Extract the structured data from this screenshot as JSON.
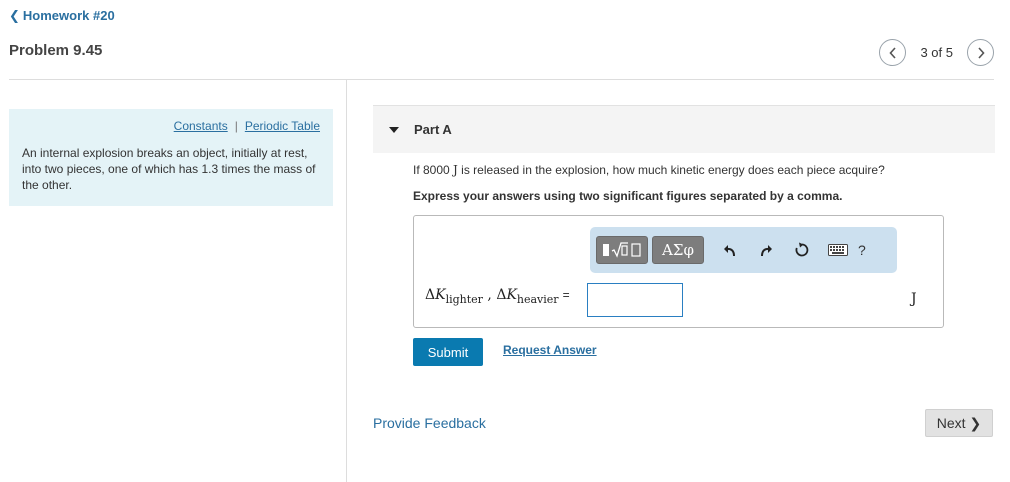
{
  "header": {
    "back_link": "Homework #20",
    "problem_title": "Problem 9.45",
    "pager_text": "3 of 5"
  },
  "info_panel": {
    "constants_link": "Constants",
    "separator": "|",
    "periodic_table_link": "Periodic Table",
    "text": "An internal explosion breaks an object, initially at rest, into two pieces, one of which has 1.3 times the mass of the other."
  },
  "part": {
    "label": "Part A",
    "question_pre": "If 8000 ",
    "question_unit": "J",
    "question_post": " is released in the explosion, how much kinetic energy does each piece acquire?",
    "instruction": "Express your answers using two significant figures separated by a comma."
  },
  "toolbar": {
    "greek_label": "ΑΣφ",
    "help_label": "?"
  },
  "equation": {
    "delta": "Δ",
    "var": "K",
    "sub1": "lighter",
    "comma": " , ",
    "sub2": "heavier",
    "equals": "=",
    "input_value": "",
    "unit": "J"
  },
  "actions": {
    "submit": "Submit",
    "request_answer": "Request Answer",
    "provide_feedback": "Provide Feedback",
    "next": "Next"
  },
  "colors": {
    "link": "#2a6fa0",
    "submit_bg": "#0a7ab0",
    "info_bg": "#e4f3f7",
    "toolbar_bg": "#cce0ef"
  }
}
